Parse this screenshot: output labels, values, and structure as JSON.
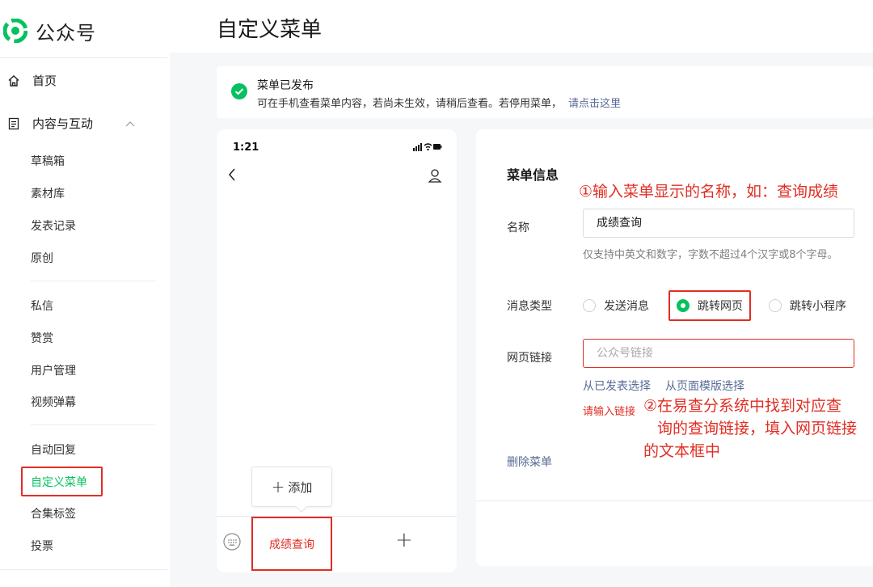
{
  "app": {
    "name": "公众号"
  },
  "sidebar": {
    "home": "首页",
    "content_group": "内容与互动",
    "items_a": [
      "草稿箱",
      "素材库",
      "发表记录",
      "原创"
    ],
    "items_b": [
      "私信",
      "赞赏",
      "用户管理",
      "视频弹幕"
    ],
    "items_c": [
      "自动回复",
      "自定义菜单",
      "合集标签",
      "投票"
    ],
    "active": "自定义菜单"
  },
  "page": {
    "title": "自定义菜单"
  },
  "notice": {
    "title": "菜单已发布",
    "desc": "可在手机查看菜单内容，若尚未生效，请稍后查看。若停用菜单，",
    "link": "请点击这里"
  },
  "phone": {
    "time": "1:21",
    "add_label": "添加",
    "menu_item": "成绩查询"
  },
  "form": {
    "section_title": "菜单信息",
    "name_label": "名称",
    "name_value": "成绩查询",
    "name_hint": "仅支持中英文和数字，字数不超过4个汉字或8个字母。",
    "type_label": "消息类型",
    "type_options": [
      "发送消息",
      "跳转网页",
      "跳转小程序"
    ],
    "type_selected": "跳转网页",
    "url_label": "网页链接",
    "url_placeholder": "公众号链接",
    "select_published": "从已发表选择",
    "select_template": "从页面模版选择",
    "url_error": "请输入链接",
    "delete_label": "删除菜单"
  },
  "annotations": {
    "step1": "①输入菜单显示的名称，如：查询成绩",
    "step2_line1": "②在易查分系统中找到对应查",
    "step2_line2": "询的查询链接，填入网页链接",
    "step2_line3": "的文本框中"
  },
  "colors": {
    "brand_green": "#07c160",
    "link_blue": "#576b95",
    "annotation_red": "#e02e24"
  }
}
